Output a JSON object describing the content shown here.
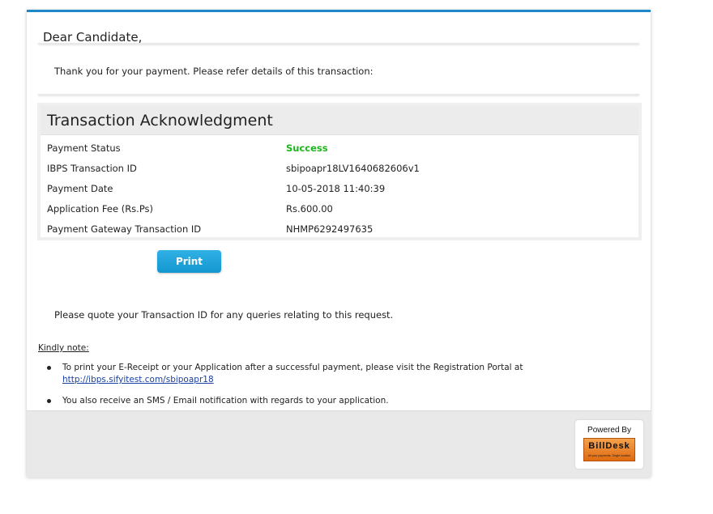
{
  "greeting": "Dear Candidate,",
  "thanks": "Thank you for your payment. Please refer details of this transaction:",
  "ack": {
    "title": "Transaction Acknowledgment",
    "rows": [
      {
        "label": "Payment Status",
        "value": "Success"
      },
      {
        "label": "IBPS Transaction ID",
        "value": "sbipoapr18LV1640682606v1"
      },
      {
        "label": "Payment Date",
        "value": "10-05-2018 11:40:39"
      },
      {
        "label": "Application Fee (Rs.Ps)",
        "value": "Rs.600.00"
      },
      {
        "label": "Payment Gateway Transaction ID",
        "value": "NHMP6292497635"
      }
    ]
  },
  "print_label": "Print",
  "quote": "Please quote your Transaction ID for any queries relating to this request.",
  "note": {
    "heading": "Kindly note:",
    "item1_text": "To print your E-Receipt or your Application after a successful payment, please visit the Registration Portal at",
    "item1_link": "http://ibps.sifyitest.com/sbipoapr18",
    "item2_text": "You also receive an SMS / Email notification with regards to your application."
  },
  "footer": {
    "powered_by": "Powered By",
    "logo_text": "BillDesk",
    "logo_tagline": "All your payments. Single location"
  },
  "colors": {
    "accent": "#1e87c8",
    "success": "#1db51d",
    "button": "#1a9fd8",
    "logo": "#e8801e"
  }
}
